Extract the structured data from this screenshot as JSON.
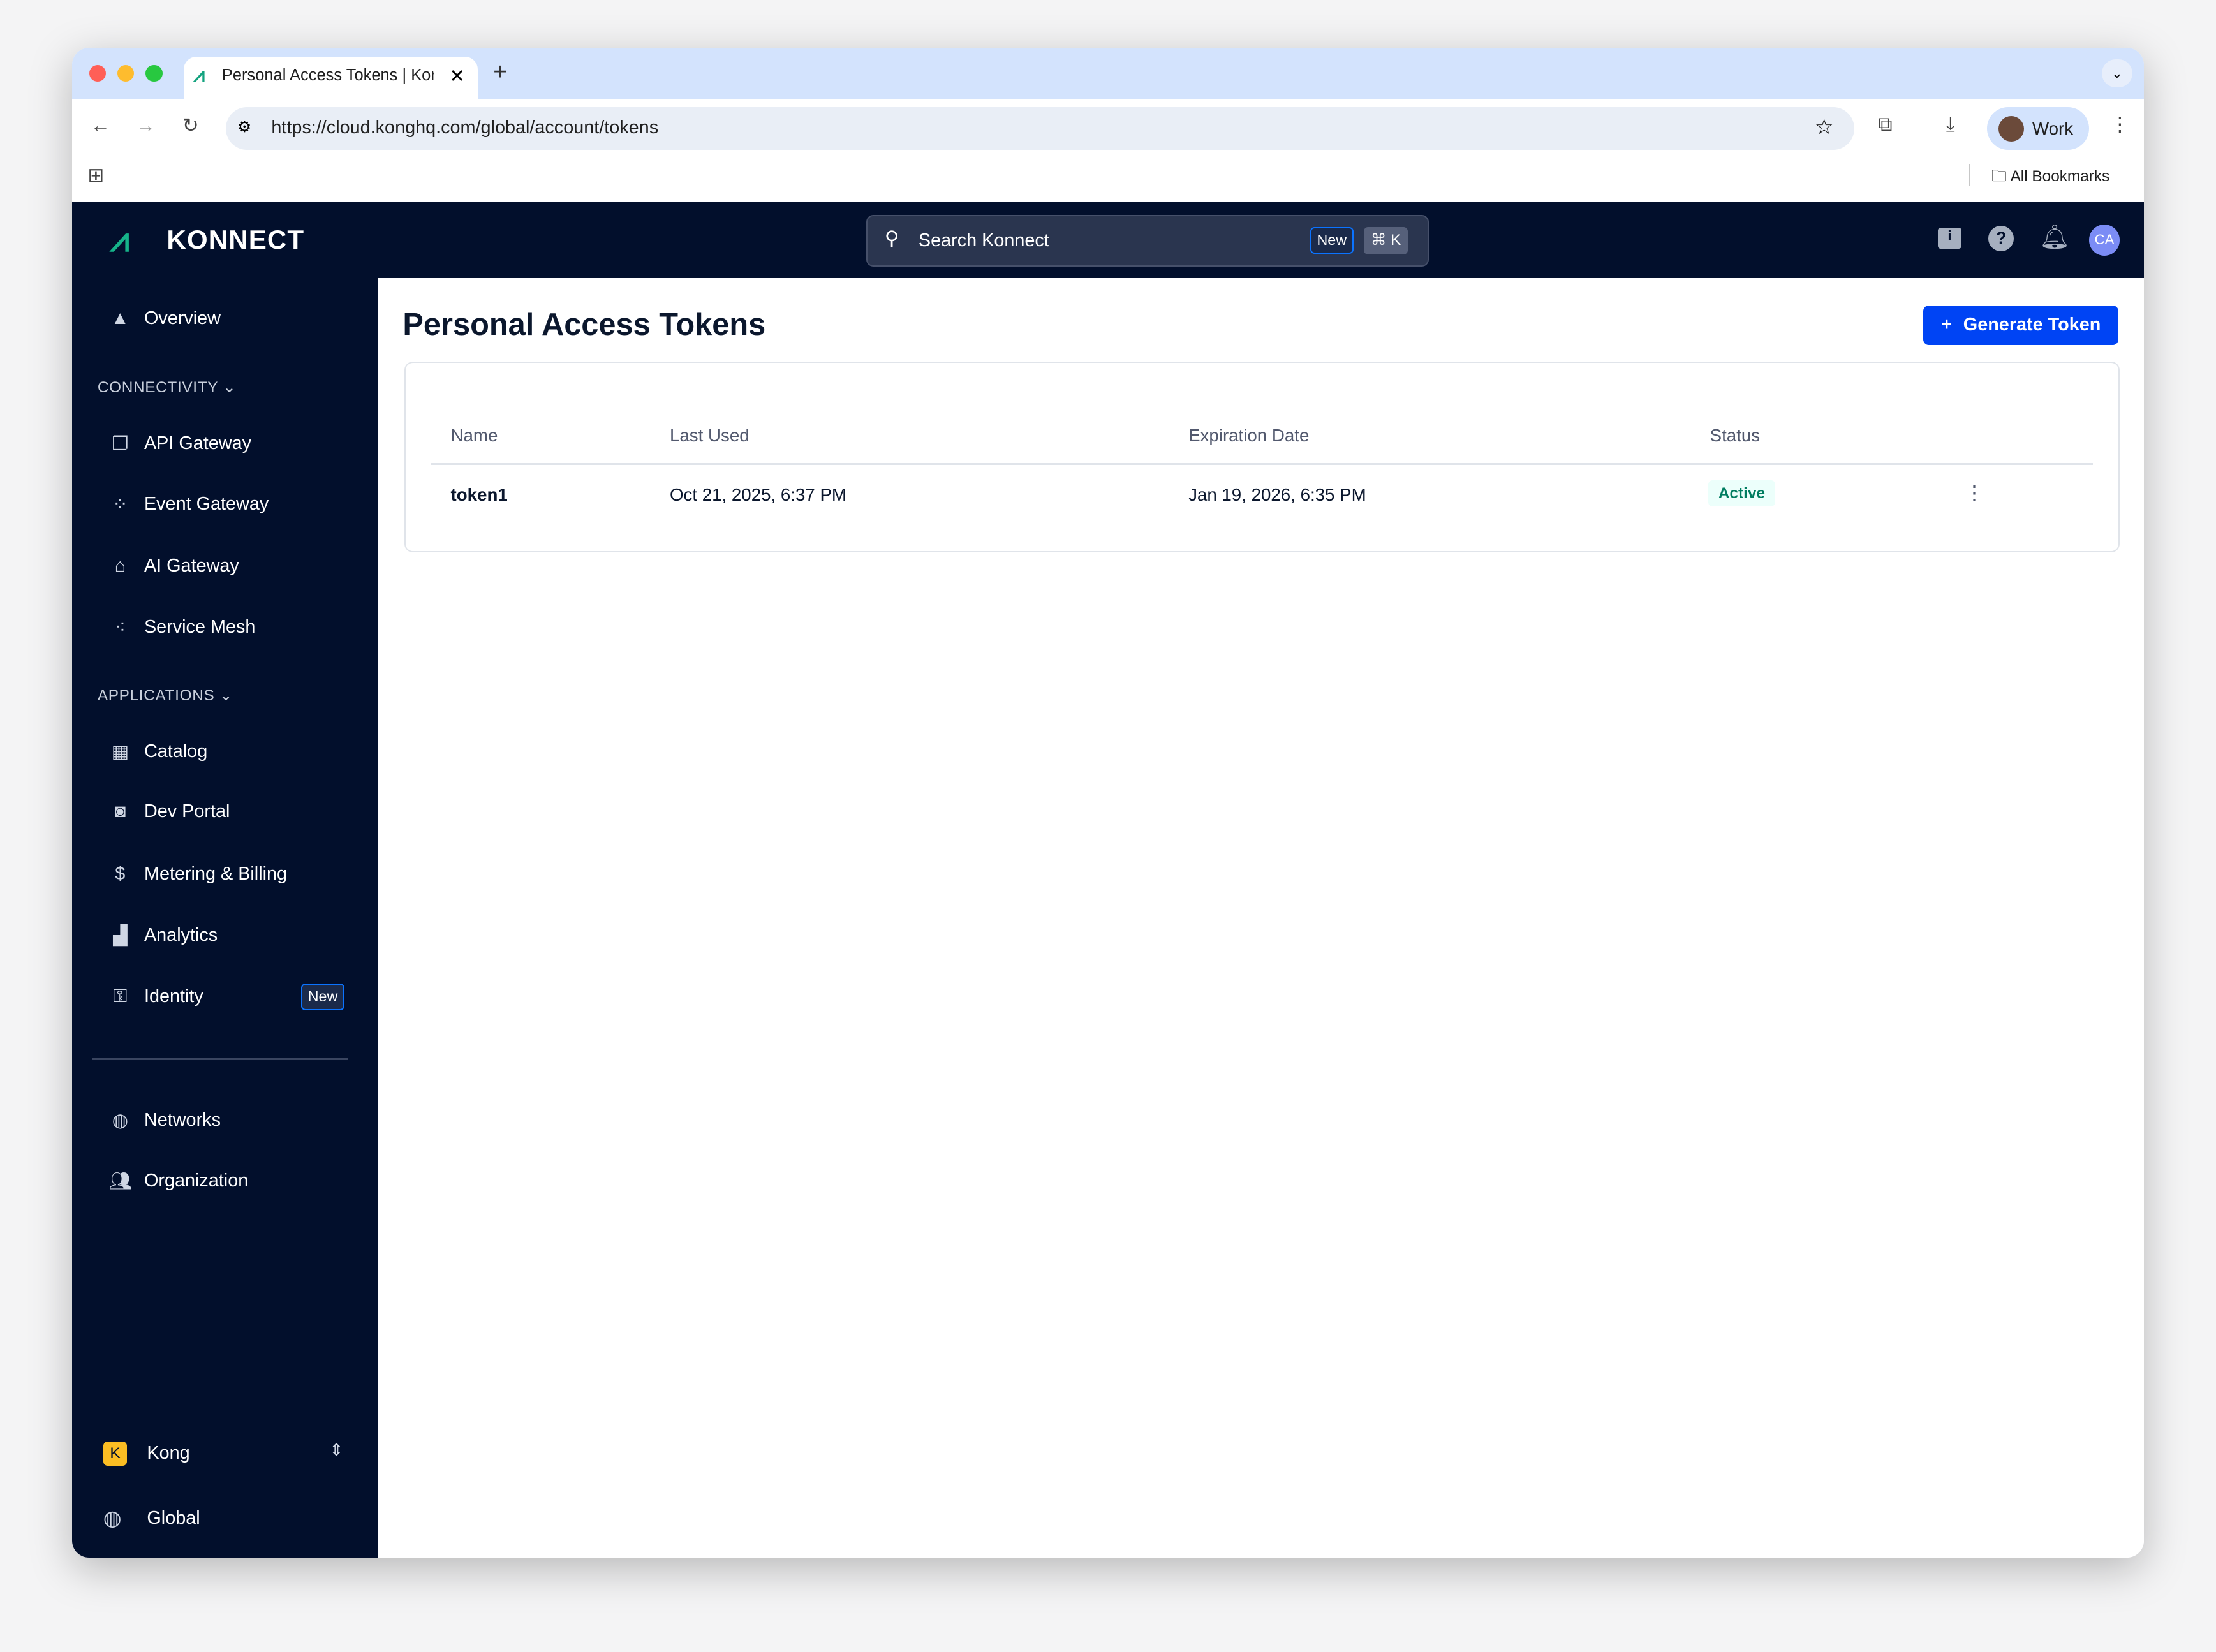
{
  "browser": {
    "tab_title": "Personal Access Tokens | Kon",
    "url": "https://cloud.konghq.com/global/account/tokens",
    "profile": "Work",
    "bookmarks": "All Bookmarks"
  },
  "header": {
    "logo": "KONNECT",
    "search_placeholder": "Search Konnect",
    "search_badge": "New",
    "shortcut": "⌘ K",
    "avatar": "CA"
  },
  "sidebar": {
    "overview": "Overview",
    "connectivity_label": "CONNECTIVITY",
    "connectivity": [
      "API Gateway",
      "Event Gateway",
      "AI Gateway",
      "Service Mesh"
    ],
    "applications_label": "APPLICATIONS",
    "applications": [
      "Catalog",
      "Dev Portal",
      "Metering & Billing",
      "Analytics",
      "Identity"
    ],
    "identity_badge": "New",
    "bottom": [
      "Networks",
      "Organization"
    ],
    "org": "Kong",
    "org_initial": "K",
    "region": "Global"
  },
  "main": {
    "title": "Personal Access Tokens",
    "generate_button": "Generate Token",
    "columns": [
      "Name",
      "Last Used",
      "Expiration Date",
      "Status"
    ],
    "rows": [
      {
        "name": "token1",
        "last_used": "Oct 21, 2025, 6:37 PM",
        "expiration": "Jan 19, 2026, 6:35 PM",
        "status": "Active"
      }
    ]
  },
  "colors": {
    "brand_dark": "#020f2c",
    "primary": "#0044f4",
    "active_green": "#007d60"
  }
}
